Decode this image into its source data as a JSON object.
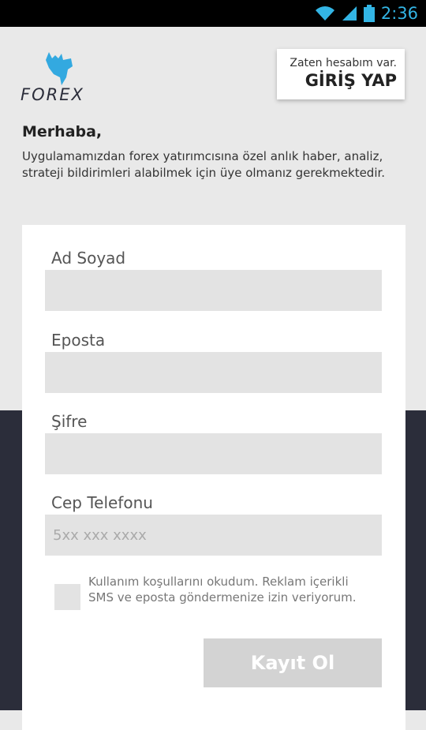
{
  "status_bar": {
    "time": "2:36",
    "icons": [
      "wifi-icon",
      "signal-icon",
      "battery-icon"
    ],
    "accent_color": "#33b5e5"
  },
  "header": {
    "logo_text": "FOREX",
    "login": {
      "subtitle": "Zaten hesabım var.",
      "label": "GİRİŞ YAP"
    }
  },
  "intro": {
    "title": "Merhaba,",
    "body": "Uygulamamızdan forex yatırımcısına özel anlık haber, analiz, strateji bildirimleri alabilmek için üye olmanız gerekmektedir."
  },
  "form": {
    "fields": [
      {
        "label": "Ad Soyad",
        "value": "",
        "placeholder": ""
      },
      {
        "label": "Eposta",
        "value": "",
        "placeholder": ""
      },
      {
        "label": "Şifre",
        "value": "",
        "placeholder": ""
      },
      {
        "label": "Cep Telefonu",
        "value": "",
        "placeholder": "5xx xxx xxxx"
      }
    ],
    "terms_text": "Kullanım koşullarını okudum. Reklam içerikli SMS ve eposta göndermenize izin veriyorum.",
    "terms_checked": false,
    "submit_label": "Kayıt Ol"
  },
  "colors": {
    "dark_bg": "#2b2d3a",
    "light_bg": "#e9e9e9",
    "logo_blue": "#33a9e0"
  }
}
